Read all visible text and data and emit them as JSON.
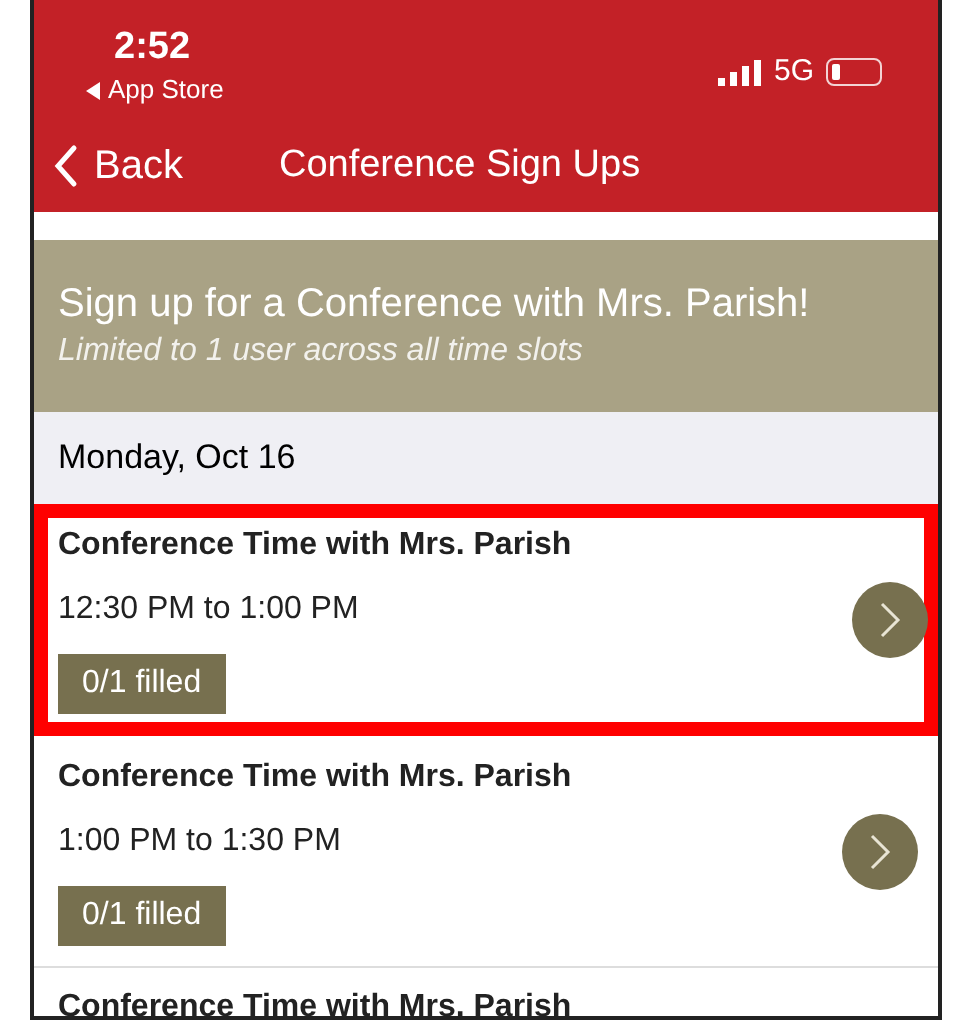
{
  "status_bar": {
    "time": "2:52",
    "back_app": "App Store",
    "network": "5G"
  },
  "nav": {
    "back": "Back",
    "title": "Conference Sign Ups"
  },
  "banner": {
    "title": "Sign up for a Conference with Mrs. Parish!",
    "subtitle": "Limited to 1 user across all time slots"
  },
  "sections": [
    {
      "date": "Monday, Oct 16",
      "rows": [
        {
          "title": "Conference Time with Mrs. Parish",
          "time": "12:30 PM to 1:00 PM",
          "filled": "0/1 filled",
          "highlighted": true
        },
        {
          "title": "Conference Time with Mrs. Parish",
          "time": "1:00 PM to 1:30 PM",
          "filled": "0/1 filled",
          "highlighted": false
        },
        {
          "title": "Conference Time with Mrs. Parish",
          "highlighted": false
        }
      ]
    }
  ]
}
